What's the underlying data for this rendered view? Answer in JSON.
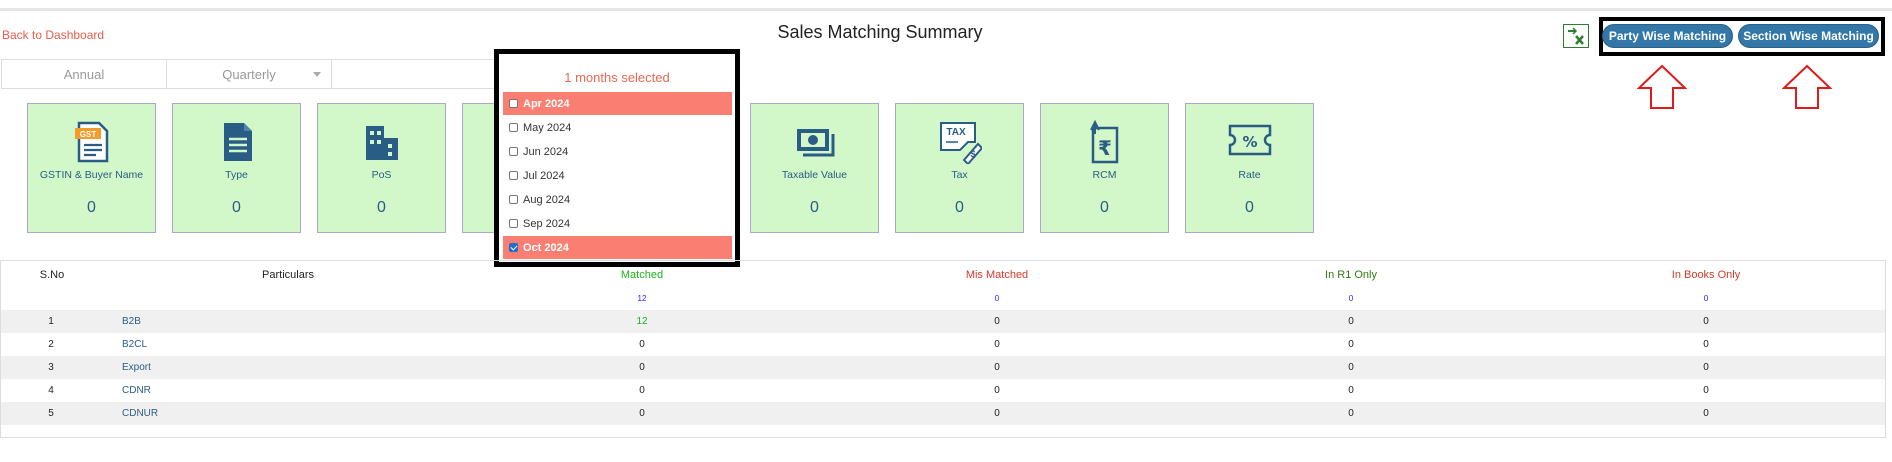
{
  "header": {
    "back_link": "Back to Dashboard",
    "title": "Sales Matching Summary",
    "party_btn": "Party Wise Matching",
    "section_btn": "Section Wise Matching"
  },
  "period_tabs": [
    "Annual",
    "Quarterly"
  ],
  "month_picker": {
    "summary": "1 months selected",
    "items": [
      {
        "label": "Apr 2024",
        "checked": false,
        "highlighted": true
      },
      {
        "label": "May 2024",
        "checked": false,
        "highlighted": false
      },
      {
        "label": "Jun 2024",
        "checked": false,
        "highlighted": false
      },
      {
        "label": "Jul 2024",
        "checked": false,
        "highlighted": false
      },
      {
        "label": "Aug 2024",
        "checked": false,
        "highlighted": false
      },
      {
        "label": "Sep 2024",
        "checked": false,
        "highlighted": false
      },
      {
        "label": "Oct 2024",
        "checked": true,
        "highlighted": true
      }
    ]
  },
  "cards": [
    {
      "label": "GSTIN & Buyer Name",
      "value": "0",
      "icon": "gst-document-icon"
    },
    {
      "label": "Type",
      "value": "0",
      "icon": "document-icon"
    },
    {
      "label": "PoS",
      "value": "0",
      "icon": "building-icon"
    },
    {
      "label": "",
      "value": "",
      "icon": ""
    },
    {
      "label": "",
      "value": "",
      "icon": ""
    },
    {
      "label": "Taxable Value",
      "value": "0",
      "icon": "cash-icon"
    },
    {
      "label": "Tax",
      "value": "0",
      "icon": "tax-tag-icon"
    },
    {
      "label": "RCM",
      "value": "0",
      "icon": "rupee-document-icon"
    },
    {
      "label": "Rate",
      "value": "0",
      "icon": "percent-ticket-icon"
    }
  ],
  "table": {
    "headers": {
      "sno": "S.No",
      "particulars": "Particulars",
      "matched": "Matched",
      "mismatched": "Mis Matched",
      "r1_only": "In R1 Only",
      "books_only": "In Books Only"
    },
    "totals": {
      "matched": "12",
      "mismatched": "0",
      "r1_only": "0",
      "books_only": "0"
    },
    "rows": [
      {
        "sno": "1",
        "particular": "B2B",
        "matched": "12",
        "mismatched": "0",
        "r1_only": "0",
        "books_only": "0"
      },
      {
        "sno": "2",
        "particular": "B2CL",
        "matched": "0",
        "mismatched": "0",
        "r1_only": "0",
        "books_only": "0"
      },
      {
        "sno": "3",
        "particular": "Export",
        "matched": "0",
        "mismatched": "0",
        "r1_only": "0",
        "books_only": "0"
      },
      {
        "sno": "4",
        "particular": "CDNR",
        "matched": "0",
        "mismatched": "0",
        "r1_only": "0",
        "books_only": "0"
      },
      {
        "sno": "5",
        "particular": "CDNUR",
        "matched": "0",
        "mismatched": "0",
        "r1_only": "0",
        "books_only": "0"
      }
    ]
  },
  "colors": {
    "accent": "#3277a8",
    "card_bg": "#d2f7c8",
    "selected_month": "#fa7f72",
    "matched": "#1db31d",
    "mismatched": "#e0362c",
    "r1_only": "#2e7d0e",
    "books_only": "#d03a2a",
    "totals_link": "#1a1aff"
  }
}
